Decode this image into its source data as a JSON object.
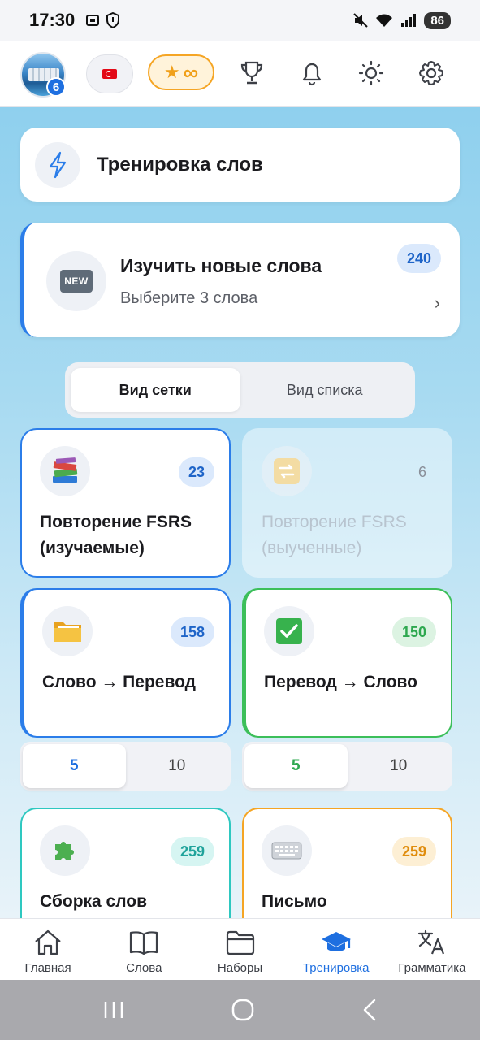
{
  "status_bar": {
    "time": "17:30",
    "battery": "86"
  },
  "top_bar": {
    "avatar_badge": "6",
    "stars_symbol": "★",
    "stars_value": "∞"
  },
  "training_header": {
    "title": "Тренировка слов"
  },
  "new_words": {
    "title": "Изучить новые слова",
    "subtitle": "Выберите 3 слова",
    "count": "240",
    "icon_text": "NEW"
  },
  "view_toggle": {
    "grid": "Вид сетки",
    "list": "Вид списка",
    "selected": "grid"
  },
  "tiles": {
    "fsrs_learning": {
      "label": "Повторение FSRS (изучаемые)",
      "count": "23",
      "accent": "#2b7de9"
    },
    "fsrs_learned": {
      "label": "Повторение FSRS (выученные)",
      "count": "6",
      "disabled": true
    },
    "word_translation": {
      "label": "Слово → Перевод",
      "count": "158",
      "accent": "#2b7de9"
    },
    "translation_word": {
      "label": "Перевод → Слово",
      "count": "150",
      "accent": "#3cbf5a"
    },
    "word_assembly": {
      "label": "Сборка слов",
      "count": "259",
      "accent": "#2ec8c0"
    },
    "writing": {
      "label": "Письмо",
      "count": "259",
      "accent": "#f5a524"
    }
  },
  "segments": {
    "left": {
      "option1": "5",
      "option2": "10",
      "selected": "5",
      "color": "#1e6fe0"
    },
    "right": {
      "option1": "5",
      "option2": "10",
      "selected": "5",
      "color": "#2ea84f"
    }
  },
  "bottom_nav": {
    "home": "Главная",
    "words": "Слова",
    "sets": "Наборы",
    "training": "Тренировка",
    "grammar": "Грамматика",
    "active": "training"
  },
  "colors": {
    "primary": "#1e6fe0",
    "warning": "#f5a524",
    "success": "#2ea84f"
  }
}
